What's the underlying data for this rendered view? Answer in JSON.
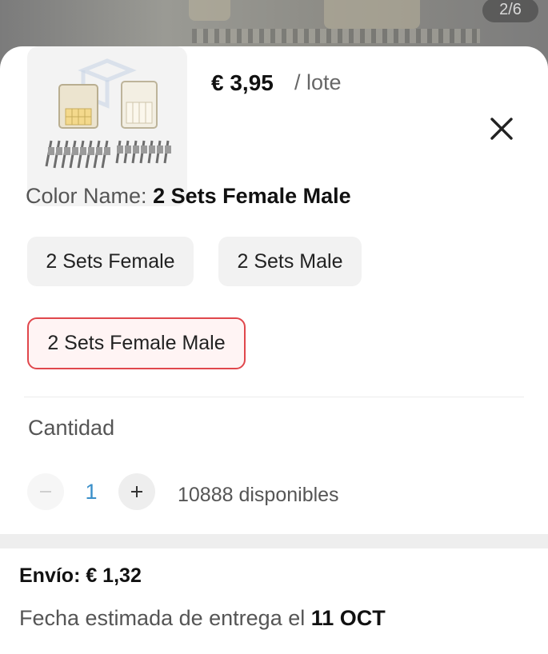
{
  "background": {
    "image_counter": "2/6"
  },
  "product": {
    "image_icon": "connector-kit-icon",
    "price": "€ 3,95",
    "unit": "/ lote"
  },
  "variant": {
    "label": "Color Name:",
    "selected": "2 Sets Female Male",
    "options": [
      {
        "label": "2 Sets Female",
        "selected": false
      },
      {
        "label": "2 Sets Male",
        "selected": false
      },
      {
        "label": "2 Sets Female Male",
        "selected": true
      }
    ]
  },
  "quantity": {
    "label": "Cantidad",
    "value": "1",
    "minus_icon": "minus-icon",
    "plus_icon": "plus-icon",
    "available": "10888 disponibles"
  },
  "shipping": {
    "text": "Envío: € 1,32",
    "delivery_prefix": "Fecha estimada de entrega el",
    "delivery_date": "11 OCT"
  },
  "colors": {
    "selected_border": "#e0474c",
    "quantity_value": "#3a8fc9"
  }
}
